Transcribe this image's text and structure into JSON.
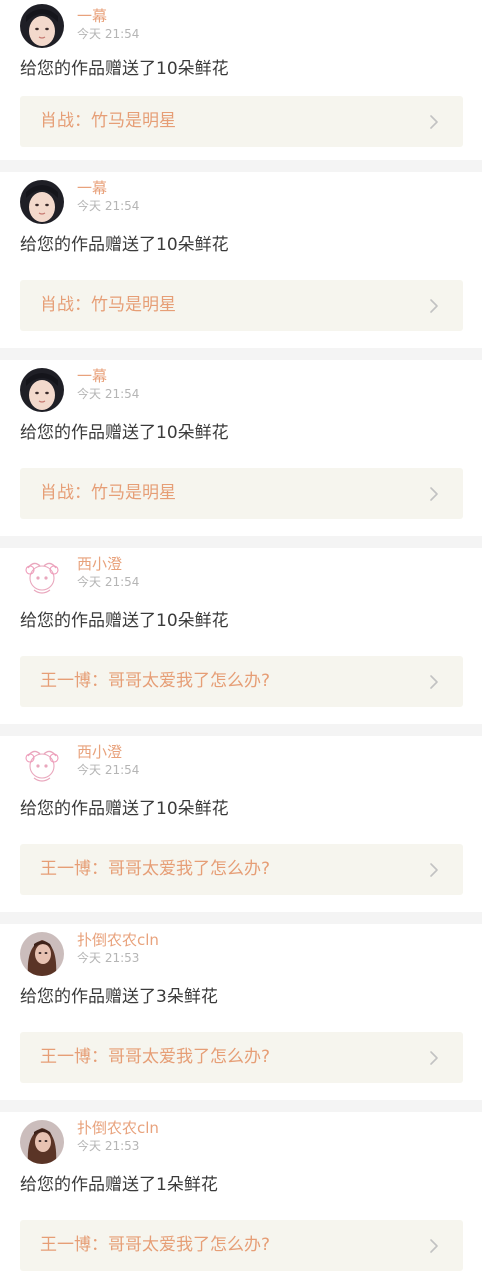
{
  "notifications": [
    {
      "user": "一幕",
      "time": "今天 21:54",
      "message": "给您的作品赠送了10朵鲜花",
      "work": "肖战：竹马是明星",
      "avatar": "girl-portrait"
    },
    {
      "user": "一幕",
      "time": "今天 21:54",
      "message": "给您的作品赠送了10朵鲜花",
      "work": "肖战：竹马是明星",
      "avatar": "girl-portrait"
    },
    {
      "user": "一幕",
      "time": "今天 21:54",
      "message": "给您的作品赠送了10朵鲜花",
      "work": "肖战：竹马是明星",
      "avatar": "girl-portrait"
    },
    {
      "user": "西小澄",
      "time": "今天 21:54",
      "message": "给您的作品赠送了10朵鲜花",
      "work": "王一博：哥哥太爱我了怎么办?",
      "avatar": "anime-sketch"
    },
    {
      "user": "西小澄",
      "time": "今天 21:54",
      "message": "给您的作品赠送了10朵鲜花",
      "work": "王一博：哥哥太爱我了怎么办?",
      "avatar": "anime-sketch"
    },
    {
      "user": "扑倒农农cln",
      "time": "今天 21:53",
      "message": "给您的作品赠送了3朵鲜花",
      "work": "王一博：哥哥太爱我了怎么办?",
      "avatar": "long-hair-portrait"
    },
    {
      "user": "扑倒农农cln",
      "time": "今天 21:53",
      "message": "给您的作品赠送了1朵鲜花",
      "work": "王一博：哥哥太爱我了怎么办?",
      "avatar": "long-hair-portrait"
    }
  ],
  "icons": {
    "chevron": "chevron-right-icon"
  },
  "colors": {
    "username": "#e8a27c",
    "work_title": "#e69e76",
    "work_bg": "#f6f5ee",
    "time": "#b5b5b5",
    "message": "#3a3a3a",
    "separator": "#f4f4f4"
  }
}
